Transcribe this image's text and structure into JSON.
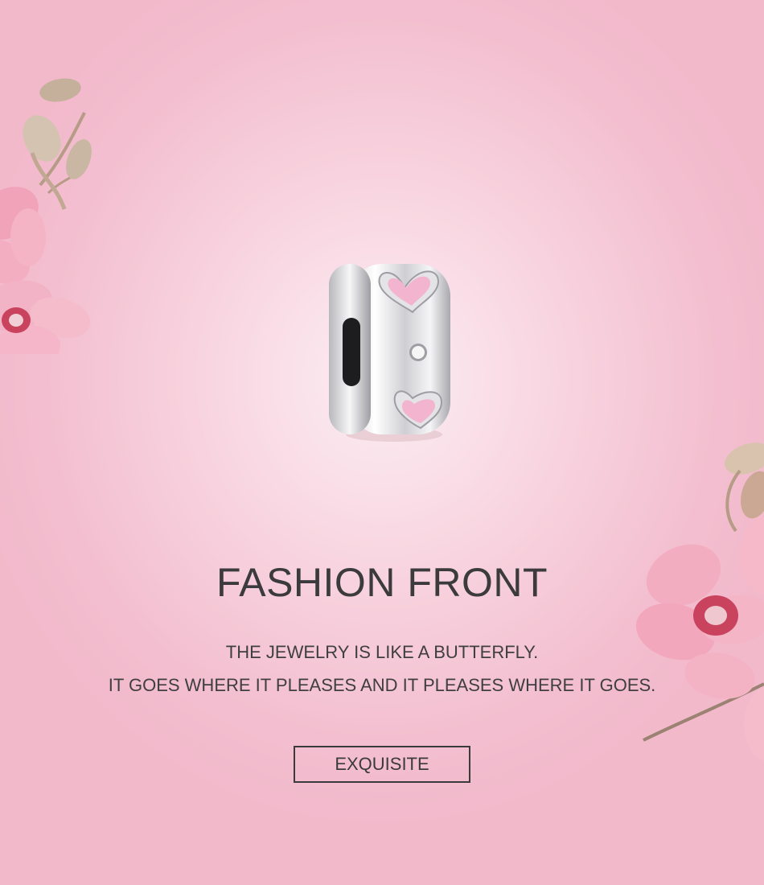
{
  "banner": {
    "title": "FASHION FRONT",
    "tagline_line1": "THE JEWELRY IS LIKE A BUTTERFLY.",
    "tagline_line2": "IT GOES WHERE IT PLEASES AND IT PLEASES WHERE IT GOES.",
    "cta_label": "EXQUISITE"
  },
  "colors": {
    "background": "#f5c6d5",
    "text": "#3b3a3c",
    "flower_pink": "#f2a6bd",
    "flower_center": "#c9435e",
    "charm_stone": "#f4b5d0"
  },
  "decorations": [
    "orchid-flower",
    "orchid-flower",
    "silver-heart-charm"
  ]
}
